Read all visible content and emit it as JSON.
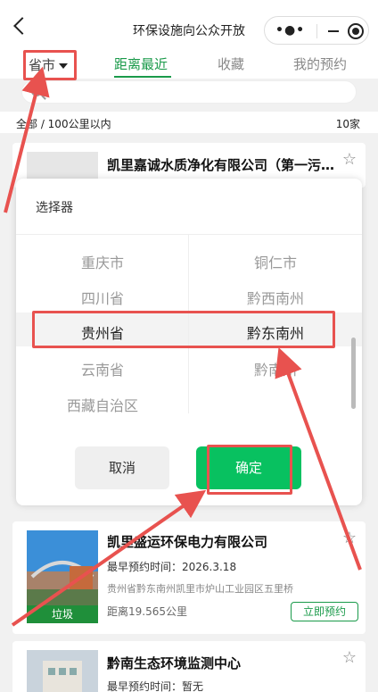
{
  "titlebar": {
    "title": "环保设施向公众开放"
  },
  "tabs": {
    "province_filter": "省市",
    "items": [
      {
        "label": "距离最近",
        "active": true
      },
      {
        "label": "收藏",
        "active": false
      },
      {
        "label": "我的预约",
        "active": false
      }
    ]
  },
  "search": {
    "placeholder": ""
  },
  "summary": {
    "filter_text": "全部 / 100公里以内",
    "count_text": "10家"
  },
  "cards": [
    {
      "name": "凯里嘉诚水质净化有限公司（第一污…",
      "reserve_time": "",
      "address": "",
      "distance": ""
    },
    {
      "name": "凯里盛运环保电力有限公司",
      "reserve_time": "最早预约时间：2026.3.18",
      "address": "贵州省黔东南州凯里市炉山工业园区五里桥",
      "distance": "距离19.565公里",
      "tag": "垃圾",
      "reserve_button": "立即预约"
    },
    {
      "name": "黔南生态环境监测中心",
      "reserve_time": "最早预约时间：暂无"
    }
  ],
  "picker": {
    "title": "选择器",
    "left_options": [
      "重庆市",
      "四川省",
      "贵州省",
      "云南省",
      "西藏自治区"
    ],
    "left_selected_index": 2,
    "right_options": [
      "铜仁市",
      "黔西南州",
      "黔东南州",
      "黔南州"
    ],
    "right_selected_index": 2,
    "cancel_label": "取消",
    "confirm_label": "确定"
  },
  "colors": {
    "accent": "#1a9a4a",
    "confirm": "#08c160",
    "annotation": "#e8524f"
  }
}
